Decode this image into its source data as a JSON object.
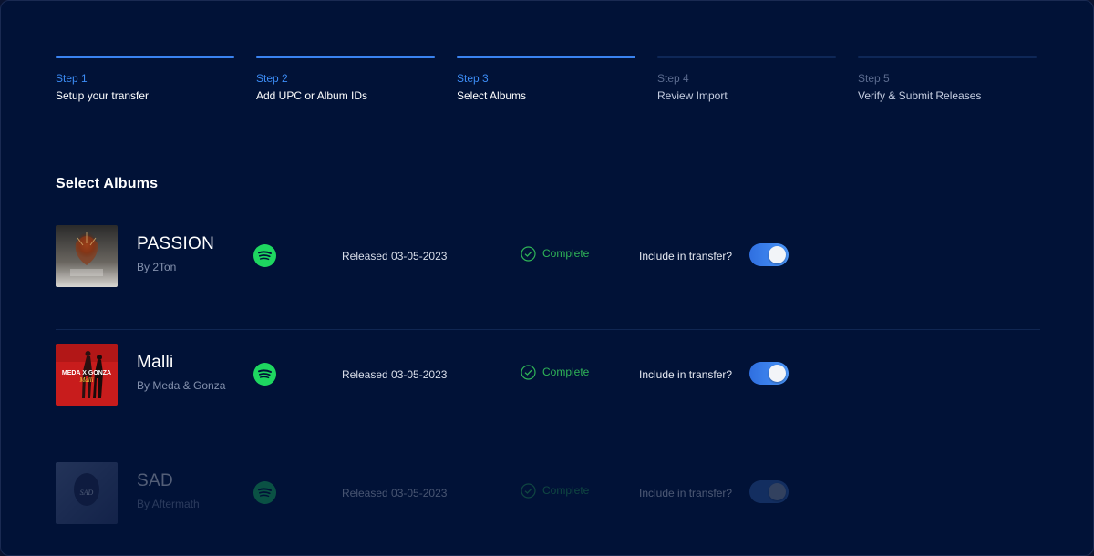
{
  "steps": [
    {
      "number": "Step 1",
      "label": "Setup your transfer",
      "active": true
    },
    {
      "number": "Step 2",
      "label": "Add UPC or Album IDs",
      "active": true
    },
    {
      "number": "Step 3",
      "label": "Select Albums",
      "active": true
    },
    {
      "number": "Step 4",
      "label": "Review Import",
      "active": false
    },
    {
      "number": "Step 5",
      "label": "Verify & Submit Releases",
      "active": false
    }
  ],
  "section_title": "Select Albums",
  "albums": [
    {
      "title": "PASSION",
      "artist": "By 2Ton",
      "service_icon": "spotify-icon",
      "released": "Released 03-05-2023",
      "status": "Complete",
      "include_label": "Include in transfer?",
      "included": true,
      "cover_text": ""
    },
    {
      "title": "Malli",
      "artist": "By Meda & Gonza",
      "service_icon": "spotify-icon",
      "released": "Released 03-05-2023",
      "status": "Complete",
      "include_label": "Include in transfer?",
      "included": true,
      "cover_text": "MEDA X GONZA"
    },
    {
      "title": "SAD",
      "artist": "By Aftermath",
      "service_icon": "spotify-icon",
      "released": "Released 03-05-2023",
      "status": "Complete",
      "include_label": "Include in transfer?",
      "included": false,
      "cover_text": ""
    }
  ],
  "colors": {
    "background": "#011237",
    "accent": "#3c8cf5",
    "success": "#2fb457",
    "spotify": "#1ed760"
  }
}
